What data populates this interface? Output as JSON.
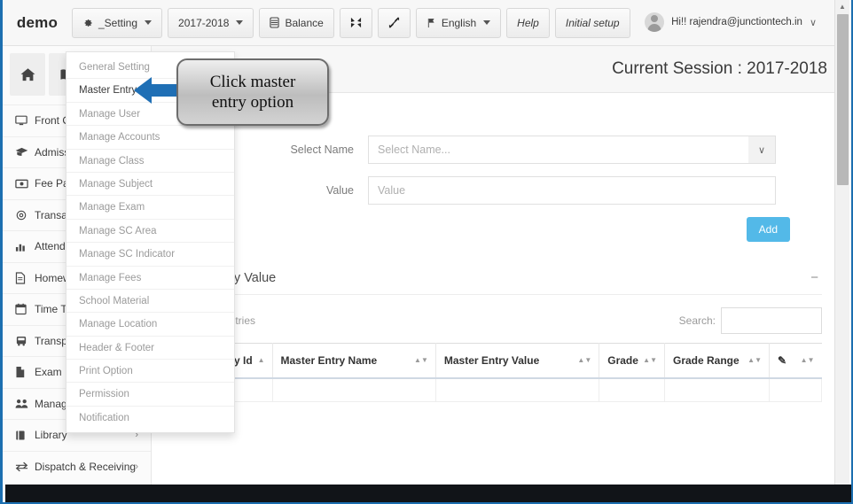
{
  "navbar": {
    "brand": "demo",
    "buttons": [
      {
        "label": "_Setting",
        "icon": "gear-icon",
        "caret": true
      },
      {
        "label": "2017-2018",
        "icon": "",
        "caret": true
      },
      {
        "label": "Balance",
        "icon": "database-icon",
        "caret": false
      },
      {
        "label": "",
        "icon": "compress-icon",
        "caret": false
      },
      {
        "label": "",
        "icon": "expand-icon",
        "caret": false
      },
      {
        "label": "English",
        "icon": "flag-icon",
        "caret": true
      },
      {
        "label": "Help",
        "icon": "",
        "caret": false
      },
      {
        "label": "Initial setup",
        "icon": "",
        "caret": false
      }
    ],
    "user": {
      "greeting": "Hi!! rajendra@junctiontech.in",
      "caret": "∨"
    }
  },
  "sidebar": {
    "tiles": [
      {
        "name": "home-icon"
      },
      {
        "name": "book-icon"
      }
    ],
    "items": [
      {
        "label": "Front Office",
        "icon": "monitor-icon",
        "chevron": ""
      },
      {
        "label": "Admission",
        "icon": "graduation-cap-icon",
        "chevron": ""
      },
      {
        "label": "Fee Payment",
        "icon": "money-icon",
        "chevron": ""
      },
      {
        "label": "Transaction",
        "icon": "gear-icon",
        "chevron": ""
      },
      {
        "label": "Attendance",
        "icon": "chart-bar-icon",
        "chevron": ""
      },
      {
        "label": "Homework",
        "icon": "document-icon",
        "chevron": ""
      },
      {
        "label": "Time Table",
        "icon": "calendar-icon",
        "chevron": ""
      },
      {
        "label": "Transport",
        "icon": "bus-icon",
        "chevron": ""
      },
      {
        "label": "Exam",
        "icon": "file-icon",
        "chevron": ""
      },
      {
        "label": "Manage Staff",
        "icon": "users-icon",
        "chevron": ""
      },
      {
        "label": "Library",
        "icon": "library-icon",
        "chevron": "›"
      },
      {
        "label": "Dispatch & Receiving",
        "icon": "exchange-icon",
        "chevron": "›"
      }
    ]
  },
  "setting_menu": {
    "items": [
      {
        "label": "General Setting",
        "active": false
      },
      {
        "label": "Master Entry",
        "active": true
      },
      {
        "label": "Manage User",
        "active": false
      },
      {
        "label": "Manage Accounts",
        "active": false
      },
      {
        "label": "Manage Class",
        "active": false
      },
      {
        "label": "Manage Subject",
        "active": false
      },
      {
        "label": "Manage Exam",
        "active": false
      },
      {
        "label": "Manage SC Area",
        "active": false
      },
      {
        "label": "Manage SC Indicator",
        "active": false
      },
      {
        "label": "Manage Fees",
        "active": false
      },
      {
        "label": "School Material",
        "active": false
      },
      {
        "label": "Manage Location",
        "active": false
      },
      {
        "label": "Header & Footer",
        "active": false
      },
      {
        "label": "Print Option",
        "active": false
      },
      {
        "label": "Permission",
        "active": false
      },
      {
        "label": "Notification",
        "active": false
      }
    ]
  },
  "callout": {
    "line1": "Click master",
    "line2": "entry option",
    "arrow_color": "#1f6fb5"
  },
  "page": {
    "title": "Current Session : 2017-2018"
  },
  "form": {
    "select_name_label": "Select Name",
    "select_name_placeholder": "Select Name...",
    "select_caret": "∨",
    "value_label": "Value",
    "value_placeholder": "Value",
    "add_button": "Add",
    "add_button_color": "#53b9e8"
  },
  "table_panel": {
    "title": "Master Entry Value",
    "collapse_icon": "−",
    "length_value": "",
    "length_caret": "▼",
    "entries_label": "entries",
    "search_label": "Search:",
    "search_value": "",
    "columns": [
      {
        "label": "Master Entry Id",
        "sort": "asc"
      },
      {
        "label": "Master Entry Name",
        "sort": "none"
      },
      {
        "label": "Master Entry Value",
        "sort": "none"
      },
      {
        "label": "Grade",
        "sort": "none"
      },
      {
        "label": "Grade Range",
        "sort": "none"
      },
      {
        "label": "✎",
        "sort": "none"
      }
    ],
    "rows": []
  },
  "scrollbar": {
    "up_arrow": "▲"
  }
}
